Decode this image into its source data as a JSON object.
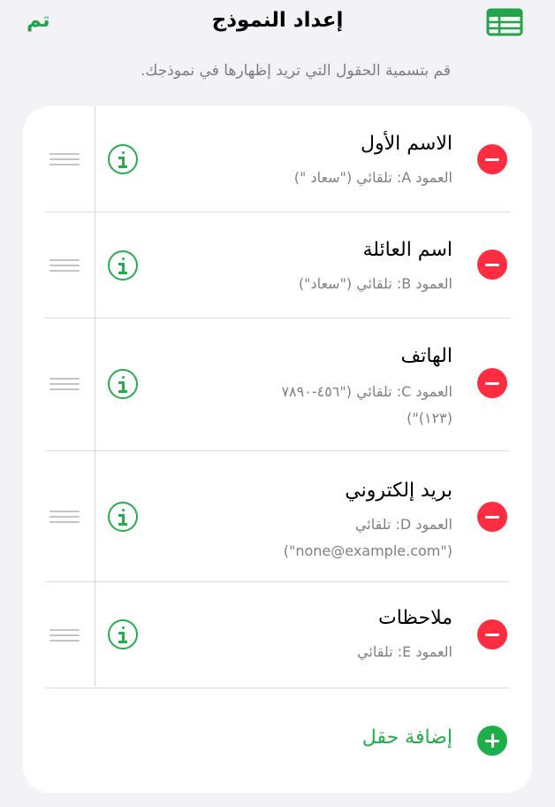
{
  "navbar": {
    "done_label": "تم",
    "title": "إعداد النموذج",
    "sheet_icon": "table-grid-icon"
  },
  "subtitle": "قم بتسمية الحقول التي تريد إظهارها في نموذجك.",
  "fields": [
    {
      "name": "الاسم الأول",
      "description": "العمود A: تلقائي (\"سعاد \")"
    },
    {
      "name": "اسم العائلة",
      "description": "العمود B: تلقائي (\"سعاد\")"
    },
    {
      "name": "الهاتف",
      "description": "العمود C: تلقائي (\"٤٥٦-٧٨٩٠ (١٢٣)\")"
    },
    {
      "name": "بريد إلكتروني",
      "description": "العمود D: تلقائي (\"none@example.com\")"
    },
    {
      "name": "ملاحظات",
      "description": "العمود E: تلقائي"
    }
  ],
  "add_field_label": "إضافة حقل",
  "colors": {
    "accent_green": "#24a44a",
    "delete_red": "#ff2d41",
    "background": "#f3f2f7"
  },
  "icons": {
    "delete": "minus-circle-icon",
    "info": "info-circle-icon",
    "reorder": "drag-handle-icon",
    "add": "plus-circle-icon"
  }
}
